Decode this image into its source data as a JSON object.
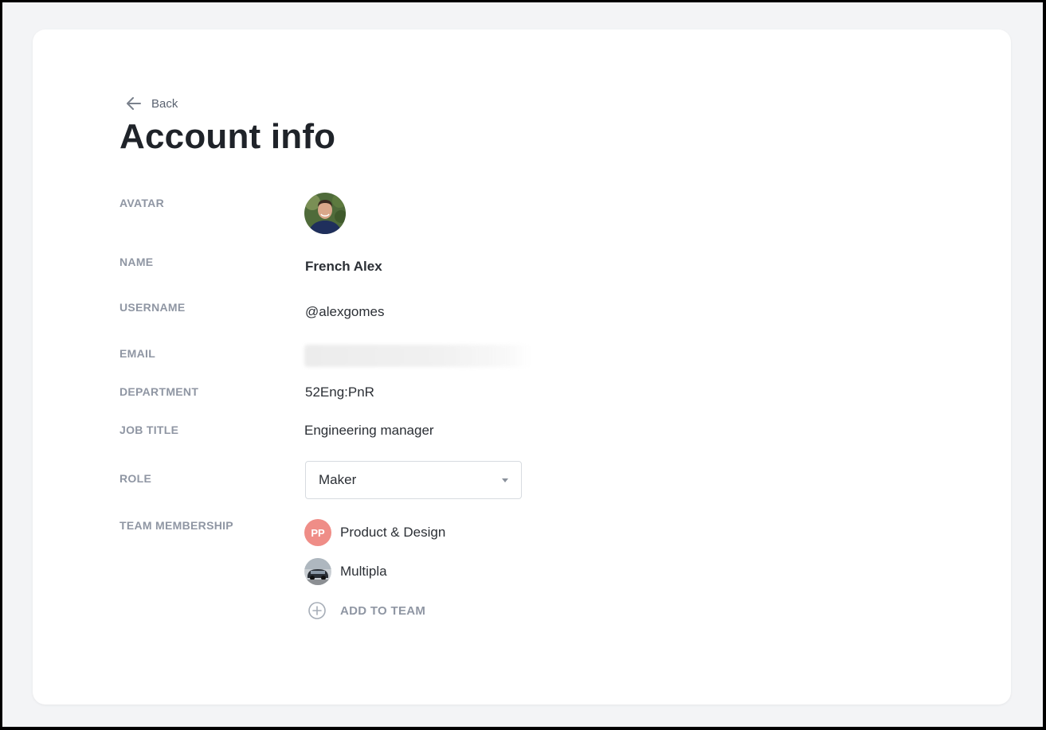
{
  "header": {
    "back_label": "Back",
    "title": "Account info"
  },
  "fields": {
    "avatar_label": "AVATAR",
    "name_label": "NAME",
    "name_value": "French Alex",
    "username_label": "USERNAME",
    "username_value": "@alexgomes",
    "email_label": "EMAIL",
    "department_label": "DEPARTMENT",
    "department_value": "52Eng:PnR",
    "job_title_label": "JOB TITLE",
    "job_title_value": "Engineering manager",
    "role_label": "ROLE",
    "role_value": "Maker",
    "team_label": "TEAM MEMBERSHIP"
  },
  "teams": [
    {
      "badge": "PP",
      "name": "Product & Design",
      "badge_color": "#ef8d87"
    },
    {
      "name": "Multipla"
    }
  ],
  "add_team_label": "ADD TO TEAM",
  "icons": {
    "back": "arrow-left-icon",
    "dropdown": "caret-down-icon",
    "add": "plus-circle-icon"
  },
  "colors": {
    "page_bg": "#f3f4f6",
    "card_bg": "#ffffff",
    "label": "#8f96a3",
    "text": "#2b2f35"
  }
}
